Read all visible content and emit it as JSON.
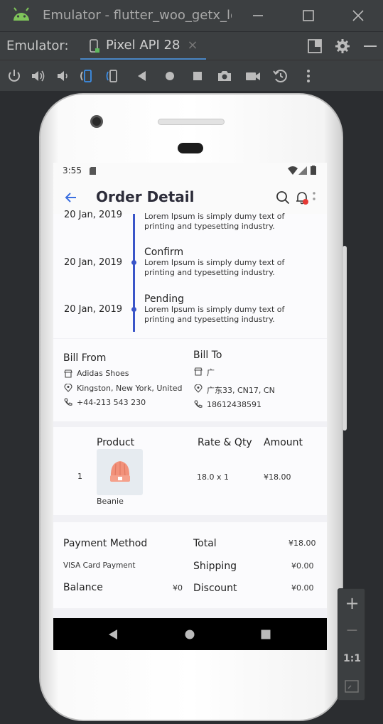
{
  "window": {
    "title": "Emulator - flutter_woo_getx_le",
    "minimize_icon": "minimize-icon",
    "maximize_icon": "maximize-icon",
    "close_icon": "close-icon"
  },
  "emulator_bar": {
    "label": "Emulator:",
    "device_tab": "Pixel API 28",
    "tab_close": "×"
  },
  "controls": [
    "power-icon",
    "volume-up-icon",
    "volume-down-icon",
    "rotate-left-icon",
    "rotate-right-icon",
    "back-icon",
    "home-icon",
    "overview-icon",
    "screenshot-icon",
    "record-icon",
    "snapshot-icon",
    "more-icon"
  ],
  "device": {
    "status": {
      "time": "3:55"
    },
    "appbar": {
      "title": "Order Detail"
    },
    "timeline": [
      {
        "date": "20 Jan, 2019",
        "status": "",
        "desc": "Lorem Ipsum is simply dumy text of printing and typesetting industry."
      },
      {
        "date": "20 Jan, 2019",
        "status": "Confirm",
        "desc": "Lorem Ipsum is simply dumy text of printing and typesetting industry."
      },
      {
        "date": "20 Jan, 2019",
        "status": "Pending",
        "desc": "Lorem Ipsum is simply dumy text of printing and typesetting industry."
      }
    ],
    "bill_from": {
      "heading": "Bill From",
      "name": "Adidas Shoes",
      "address": "Kingston, New York, United",
      "phone": "+44-213 543 230"
    },
    "bill_to": {
      "heading": "Bill To",
      "name": "广",
      "address": "广东33, CN17, CN",
      "phone": "18612438591"
    },
    "product_table": {
      "headers": [
        "Product",
        "Rate & Qty",
        "Amount"
      ],
      "row": {
        "index": "1",
        "name": "Beanie",
        "rate_qty": "18.0 x 1",
        "amount": "¥18.00"
      }
    },
    "payment": {
      "method_label": "Payment Method",
      "method_value": "VISA Card Payment",
      "balance_label": "Balance",
      "balance_value": "¥0",
      "total_label": "Total",
      "total_value": "¥18.00",
      "shipping_label": "Shipping",
      "shipping_value": "¥0.00",
      "discount_label": "Discount",
      "discount_value": "¥0.00"
    }
  },
  "zoom": {
    "plus": "+",
    "minus": "−",
    "ratio": "1:1"
  },
  "colors": {
    "accent": "#3a55c8",
    "badge": "#e53935",
    "chrome": "#3c3f41",
    "tab_underline": "#4a88c7"
  }
}
